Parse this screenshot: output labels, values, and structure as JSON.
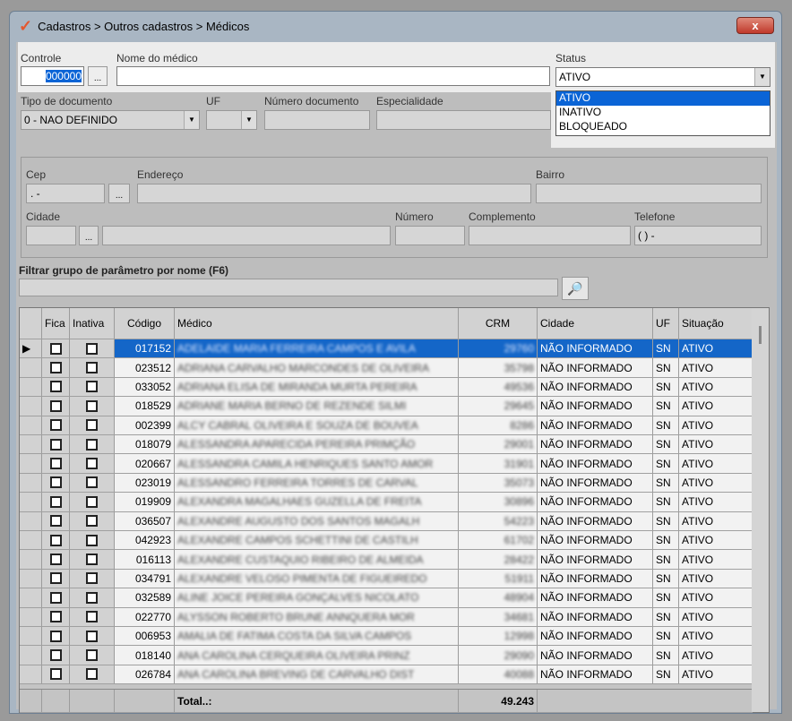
{
  "window": {
    "title": "Cadastros > Outros cadastros > Médicos",
    "close": "x"
  },
  "form": {
    "controle_label": "Controle",
    "controle_value": "000000",
    "ellipsis": "...",
    "nome_label": "Nome do médico",
    "nome_value": "",
    "status_label": "Status",
    "status_value": "ATIVO",
    "status_options": [
      "ATIVO",
      "INATIVO",
      "BLOQUEADO"
    ],
    "tipo_doc_label": "Tipo de documento",
    "tipo_doc_value": "0 - NAO DEFINIDO",
    "uf_label": "UF",
    "numero_doc_label": "Número documento",
    "especialidade_label": "Especialidade",
    "cep_label": "Cep",
    "cep_value": "  .  -",
    "endereco_label": "Endereço",
    "bairro_label": "Bairro",
    "cidade_label": "Cidade",
    "numero_label": "Número",
    "complemento_label": "Complemento",
    "telefone_label": "Telefone",
    "telefone_value": "(  )     -",
    "filtro_label": "Filtrar grupo de parâmetro por nome (F6)"
  },
  "grid": {
    "columns": [
      "Fica",
      "Inativa",
      "Código",
      "Médico",
      "CRM",
      "Cidade",
      "UF",
      "Situação"
    ],
    "rows": [
      {
        "codigo": "017152",
        "medico": "ADELAIDE MARIA FERREIRA CAMPOS E AVILA",
        "crm": "29760",
        "cidade": "NÃO INFORMADO",
        "uf": "SN",
        "situacao": "ATIVO"
      },
      {
        "codigo": "023512",
        "medico": "ADRIANA CARVALHO MARCONDES DE OLIVEIRA",
        "crm": "35798",
        "cidade": "NÃO INFORMADO",
        "uf": "SN",
        "situacao": "ATIVO"
      },
      {
        "codigo": "033052",
        "medico": "ADRIANA ELISA DE MIRANDA MURTA PEREIRA",
        "crm": "49536",
        "cidade": "NÃO INFORMADO",
        "uf": "SN",
        "situacao": "ATIVO"
      },
      {
        "codigo": "018529",
        "medico": "ADRIANE MARIA BERNO DE REZENDE SILMI",
        "crm": "29645",
        "cidade": "NÃO INFORMADO",
        "uf": "SN",
        "situacao": "ATIVO"
      },
      {
        "codigo": "002399",
        "medico": "ALCY CABRAL OLIVEIRA E SOUZA DE BOUVEA",
        "crm": "8286",
        "cidade": "NÃO INFORMADO",
        "uf": "SN",
        "situacao": "ATIVO"
      },
      {
        "codigo": "018079",
        "medico": "ALESSANDRA APARECIDA PEREIRA PRIMÇÃO",
        "crm": "29001",
        "cidade": "NÃO INFORMADO",
        "uf": "SN",
        "situacao": "ATIVO"
      },
      {
        "codigo": "020667",
        "medico": "ALESSANDRA CAMILA HENRIQUES SANTO AMOR",
        "crm": "31901",
        "cidade": "NÃO INFORMADO",
        "uf": "SN",
        "situacao": "ATIVO"
      },
      {
        "codigo": "023019",
        "medico": "ALESSANDRO FERREIRA TORRES DE CARVAL",
        "crm": "35073",
        "cidade": "NÃO INFORMADO",
        "uf": "SN",
        "situacao": "ATIVO"
      },
      {
        "codigo": "019909",
        "medico": "ALEXANDRA MAGALHAES GUZELLA DE FREITA",
        "crm": "30896",
        "cidade": "NÃO INFORMADO",
        "uf": "SN",
        "situacao": "ATIVO"
      },
      {
        "codigo": "036507",
        "medico": "ALEXANDRE AUGUSTO DOS SANTOS MAGALH",
        "crm": "54223",
        "cidade": "NÃO INFORMADO",
        "uf": "SN",
        "situacao": "ATIVO"
      },
      {
        "codigo": "042923",
        "medico": "ALEXANDRE CAMPOS SCHETTINI DE CASTILH",
        "crm": "61702",
        "cidade": "NÃO INFORMADO",
        "uf": "SN",
        "situacao": "ATIVO"
      },
      {
        "codigo": "016113",
        "medico": "ALEXANDRE CUSTAQUIO RIBEIRO DE ALMEIDA",
        "crm": "28422",
        "cidade": "NÃO INFORMADO",
        "uf": "SN",
        "situacao": "ATIVO"
      },
      {
        "codigo": "034791",
        "medico": "ALEXANDRE VELOSO PIMENTA DE FIGUEIREDO",
        "crm": "51911",
        "cidade": "NÃO INFORMADO",
        "uf": "SN",
        "situacao": "ATIVO"
      },
      {
        "codigo": "032589",
        "medico": "ALINE JOICE PEREIRA GONÇALVES NICOLATO",
        "crm": "48904",
        "cidade": "NÃO INFORMADO",
        "uf": "SN",
        "situacao": "ATIVO"
      },
      {
        "codigo": "022770",
        "medico": "ALYSSON ROBERTO BRUNE ANNQUERA MOR",
        "crm": "34681",
        "cidade": "NÃO INFORMADO",
        "uf": "SN",
        "situacao": "ATIVO"
      },
      {
        "codigo": "006953",
        "medico": "AMALIA DE FATIMA COSTA DA SILVA CAMPOS",
        "crm": "12998",
        "cidade": "NÃO INFORMADO",
        "uf": "SN",
        "situacao": "ATIVO"
      },
      {
        "codigo": "018140",
        "medico": "ANA CAROLINA CERQUEIRA OLIVEIRA PRINZ",
        "crm": "29090",
        "cidade": "NÃO INFORMADO",
        "uf": "SN",
        "situacao": "ATIVO"
      },
      {
        "codigo": "026784",
        "medico": "ANA CAROLINA BREVING DE CARVALHO DIST",
        "crm": "40088",
        "cidade": "NÃO INFORMADO",
        "uf": "SN",
        "situacao": "ATIVO"
      }
    ],
    "total_label": "Total..:",
    "total_value": "49.243"
  }
}
